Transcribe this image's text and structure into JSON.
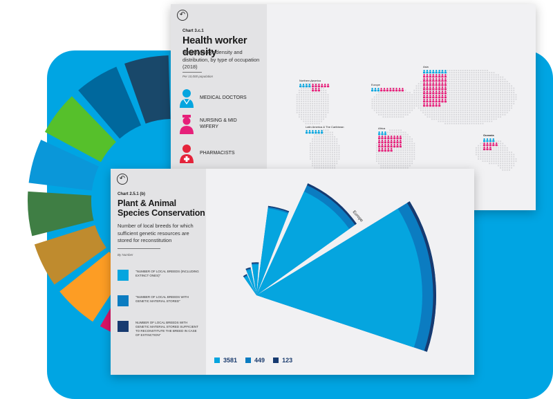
{
  "colors": {
    "background_blue": "#00a5e3",
    "series_total": "#05a5df",
    "series_genetic": "#0b7cc1",
    "series_sufficient": "#173a70",
    "sdg_wheel": [
      "#e5243b",
      "#dda63a",
      "#4c9f38",
      "#c5192d",
      "#ff3a21",
      "#26bde2",
      "#fcc30b",
      "#a21942",
      "#fd6925",
      "#dd1367",
      "#fd9d24",
      "#bf8b2e",
      "#3f7e44",
      "#0a97d9",
      "#56c02b",
      "#00689d",
      "#19486a"
    ]
  },
  "card1": {
    "chart_number": "Chart 3.c.1",
    "title": "Health worker density",
    "subtitle": "Health worker density and distribution, by type of occupation (2018)",
    "note": "Per 10,000 population",
    "occupations": [
      {
        "label": "MEDICAL DOCTORS",
        "color": "#05a5df",
        "icon": "doctor-icon"
      },
      {
        "label": "NURSING & MID WIFERY",
        "color": "#e6207a",
        "icon": "nurse-icon"
      },
      {
        "label": "PHARMACISTS",
        "color": "#e5243b",
        "icon": "pharmacist-icon"
      }
    ],
    "regions": [
      {
        "name": "Northern America"
      },
      {
        "name": "Europe"
      },
      {
        "name": "Asia"
      },
      {
        "name": "Latin America & The Caribbean"
      },
      {
        "name": "Africa"
      },
      {
        "name": "Oceania"
      }
    ]
  },
  "card2": {
    "chart_number": "Chart 2.5.1 (b)",
    "title": "Plant & Animal Species Conservation",
    "subtitle": "Number of local breeds for which sufficient genetic resources are stored for reconstitution",
    "note": "By Number",
    "legend": [
      {
        "label": "\"NUMBER OF LOCAL BREEDS (INCLUDING EXTINCT ONES)\""
      },
      {
        "label": "\"NUMBER OF LOCAL BREEDS WITH GENETIC MATERIAL STORED\""
      },
      {
        "label": "NUMBER OF LOCAL BREEDS WITH GENETIC MATERIAL STORED SUFFICIENT TO RECONSTITUTE THE BREED IN CASE OF EXTINCTION\""
      }
    ]
  },
  "chart_data": {
    "type": "pie",
    "variant": "polar-area",
    "title": "Plant & Animal Species Conservation",
    "series": [
      {
        "name": "\"NUMBER OF LOCAL BREEDS (INCLUDING EXTINCT ONES)\"",
        "color": "#05a5df"
      },
      {
        "name": "\"NUMBER OF LOCAL BREEDS WITH GENETIC MATERIAL STORED\"",
        "color": "#0b7cc1"
      },
      {
        "name": "NUMBER OF LOCAL BREEDS WITH GENETIC MATERIAL STORED SUFFICIENT TO RECONSTITUTE THE BREED IN CASE OF EXTINCTION\"",
        "color": "#173a70"
      }
    ],
    "totals": [
      "3581",
      "449",
      "123"
    ],
    "sectors": [
      {
        "label": "",
        "total": 3581,
        "genetic": 230,
        "sufficient": 60
      },
      {
        "label": "Europe",
        "total": 1680,
        "genetic": 150,
        "sufficient": 40
      },
      {
        "label": "",
        "total": 900,
        "genetic": 40,
        "sufficient": 15
      },
      {
        "label": "",
        "total": 120,
        "genetic": 8,
        "sufficient": 4
      },
      {
        "label": "",
        "total": 90,
        "genetic": 6,
        "sufficient": 2
      },
      {
        "label": "",
        "total": 60,
        "genetic": 4,
        "sufficient": 1
      }
    ]
  }
}
